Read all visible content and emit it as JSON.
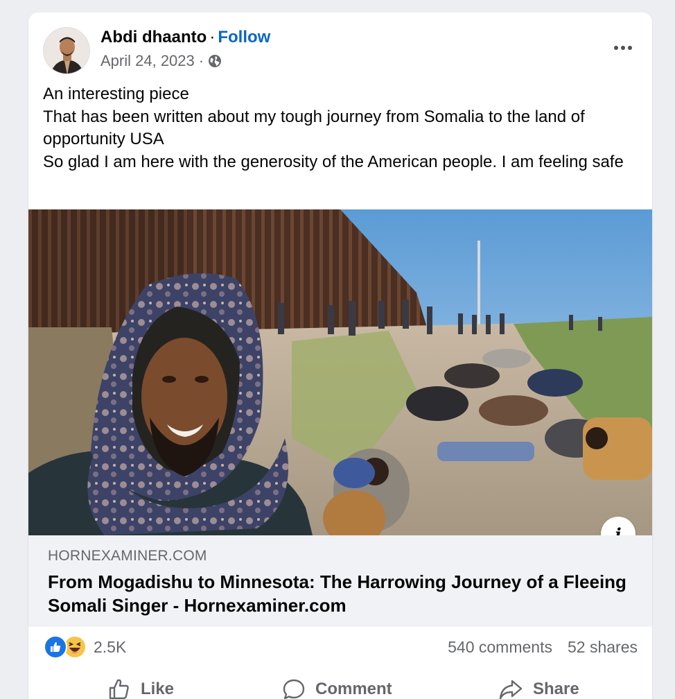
{
  "post": {
    "author": "Abdi dhaanto",
    "separator": "·",
    "follow_label": "Follow",
    "date": "April 24, 2023",
    "audience_icon": "globe-icon",
    "text_lines": [
      "An interesting piece",
      "That has been written about my tough journey from Somalia to the land of opportunity USA",
      "So glad I am here with the generosity of the American people. I am feeling safe"
    ]
  },
  "link_preview": {
    "domain": "HORNEXAMINER.COM",
    "title": "From Mogadishu to Minnesota: The Harrowing Journey of a Fleeing Somali Singer - Hornexaminer.com",
    "info_icon": "info-icon",
    "info_label": "i"
  },
  "stats": {
    "reaction_icons": [
      "like-reaction-icon",
      "haha-reaction-icon"
    ],
    "reactions_count": "2.5K",
    "comments": "540 comments",
    "shares": "52 shares"
  },
  "actions": {
    "like_label": "Like",
    "comment_label": "Comment",
    "share_label": "Share"
  },
  "colors": {
    "follow": "#0866c9",
    "like_reaction": "#1b74e4",
    "secondary_text": "#65676b",
    "link_box_bg": "#f0f2f5"
  }
}
